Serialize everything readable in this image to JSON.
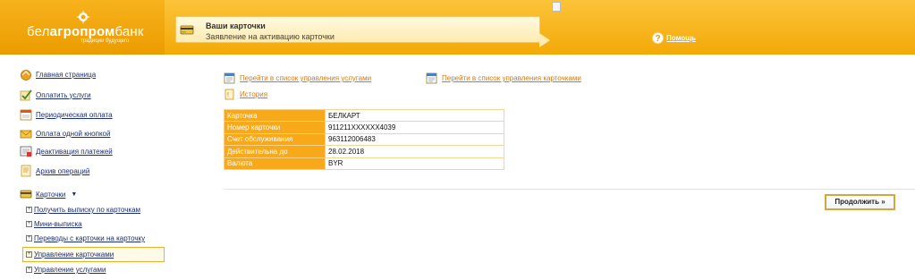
{
  "header": {
    "bank_name_prefix": "бел",
    "bank_name_bold": "агропром",
    "bank_name_suffix": "банк",
    "tagline": "традиции будущего",
    "info_title": "Ваши карточки",
    "info_subtitle": "Заявление на активацию карточки",
    "help_label": "Помощь"
  },
  "sidebar": {
    "items": [
      {
        "label": "Главная страница",
        "icon": "home-icon"
      },
      {
        "label": "Оплатить услуги",
        "icon": "checkmark-icon"
      },
      {
        "label": "Периодическая оплата",
        "icon": "calendar-icon"
      },
      {
        "label": "Оплата одной кнопкой",
        "icon": "envelope-icon"
      },
      {
        "label": "Деактивация платежей",
        "icon": "deactivate-icon"
      },
      {
        "label": "Архив операций",
        "icon": "archive-icon"
      },
      {
        "label": "Карточки",
        "icon": "card-icon"
      }
    ],
    "sub_items": [
      {
        "label": "Получить выписку по карточкам"
      },
      {
        "label": "Мини-выписка"
      },
      {
        "label": "Переводы с карточки на карточку"
      },
      {
        "label": "Управление карточками"
      },
      {
        "label": "Управление услугами"
      }
    ]
  },
  "main": {
    "links": {
      "services": "Перейти в список управления услугами",
      "cards": "Перейти в список управления карточками",
      "history": "История"
    },
    "table": [
      {
        "key": "Карточка",
        "value": "БЕЛКАРТ"
      },
      {
        "key": "Номер карточки",
        "value": "911211XXXXXX4039"
      },
      {
        "key": "Счет обслуживания",
        "value": "963112006483"
      },
      {
        "key": "Действительна до",
        "value": "28.02.2018"
      },
      {
        "key": "Валюта",
        "value": "BYR"
      }
    ],
    "continue_label": "Продолжить »"
  },
  "colors": {
    "accent": "#f7a91a",
    "link": "#1c2e75",
    "link_orange": "#d07b14"
  }
}
